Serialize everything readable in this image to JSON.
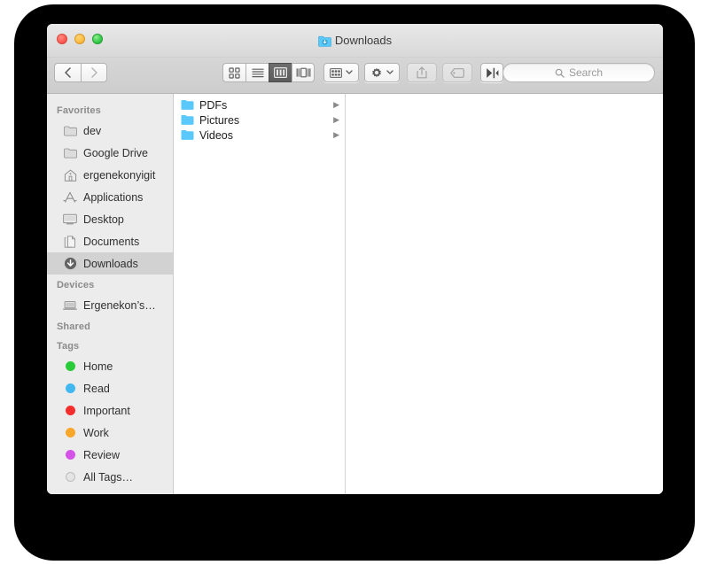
{
  "window": {
    "title": "Downloads",
    "title_icon": "downloads-folder-icon",
    "traffic_lights": [
      {
        "name": "close-button",
        "label": "Close",
        "color": "#fc5b52"
      },
      {
        "name": "minimize-button",
        "label": "Minimize",
        "color": "#fdbc40"
      },
      {
        "name": "zoom-button",
        "label": "Zoom",
        "color": "#35c94a"
      }
    ]
  },
  "toolbar": {
    "back_label": "‹",
    "forward_label": "›",
    "back_name": "back-button",
    "forward_name": "forward-button",
    "view_modes": [
      {
        "name": "icon-view-button",
        "label": "Icon View",
        "icon": "grid-icon",
        "active": false
      },
      {
        "name": "list-view-button",
        "label": "List View",
        "icon": "list-icon",
        "active": false
      },
      {
        "name": "column-view-button",
        "label": "Column View",
        "icon": "columns-icon",
        "active": true
      },
      {
        "name": "gallery-view-button",
        "label": "Gallery View",
        "icon": "gallery-icon",
        "active": false
      }
    ],
    "arrange_label": "Arrange",
    "arrange_icon": "arrange-grid-icon",
    "action_label": "Action",
    "action_icon": "gear-icon",
    "share_label": "Share",
    "share_icon": "share-icon",
    "tag_label": "Tags",
    "tag_icon": "tag-icon",
    "dropbox_label": "Dropbox",
    "dropbox_icon": "dropbox-bowtie-icon",
    "chevron": "⌄"
  },
  "search": {
    "name": "search-input",
    "placeholder": "Search",
    "value": "",
    "icon": "search-icon"
  },
  "sidebar": {
    "sections": [
      {
        "header": "Favorites",
        "items": [
          {
            "label": "dev",
            "icon": "folder-icon",
            "selected": false
          },
          {
            "label": "Google Drive",
            "icon": "folder-icon",
            "selected": false
          },
          {
            "label": "ergenekonyigit",
            "icon": "home-icon",
            "selected": false
          },
          {
            "label": "Applications",
            "icon": "applications-icon",
            "selected": false
          },
          {
            "label": "Desktop",
            "icon": "desktop-icon",
            "selected": false
          },
          {
            "label": "Documents",
            "icon": "documents-icon",
            "selected": false
          },
          {
            "label": "Downloads",
            "icon": "downloads-icon",
            "selected": true
          }
        ]
      },
      {
        "header": "Devices",
        "items": [
          {
            "label": "Ergenekon’s…",
            "icon": "laptop-icon",
            "selected": false
          }
        ]
      },
      {
        "header": "Shared",
        "items": []
      },
      {
        "header": "Tags",
        "items": [
          {
            "label": "Home",
            "icon": "tag-dot-icon",
            "color": "#29cc38",
            "selected": false
          },
          {
            "label": "Read",
            "icon": "tag-dot-icon",
            "color": "#41b8f0",
            "selected": false
          },
          {
            "label": "Important",
            "icon": "tag-dot-icon",
            "color": "#f62d2d",
            "selected": false
          },
          {
            "label": "Work",
            "icon": "tag-dot-icon",
            "color": "#f8a72a",
            "selected": false
          },
          {
            "label": "Review",
            "icon": "tag-dot-icon",
            "color": "#d452e8",
            "selected": false
          },
          {
            "label": "All Tags…",
            "icon": "tag-dot-icon",
            "color": "#d8d8d8",
            "selected": false
          }
        ]
      }
    ]
  },
  "file_list": {
    "column_one": [
      {
        "label": "PDFs",
        "icon": "folder-icon",
        "has_children": true,
        "chevron": "▶"
      },
      {
        "label": "Pictures",
        "icon": "folder-icon",
        "has_children": true,
        "chevron": "▶"
      },
      {
        "label": "Videos",
        "icon": "folder-icon",
        "has_children": true,
        "chevron": "▶"
      }
    ],
    "column_two": []
  },
  "colors": {
    "folder_blue": "#5ac8fa",
    "sidebar_bg": "#ececec",
    "selection": "#d2d2d2",
    "backdrop": "#000000"
  }
}
